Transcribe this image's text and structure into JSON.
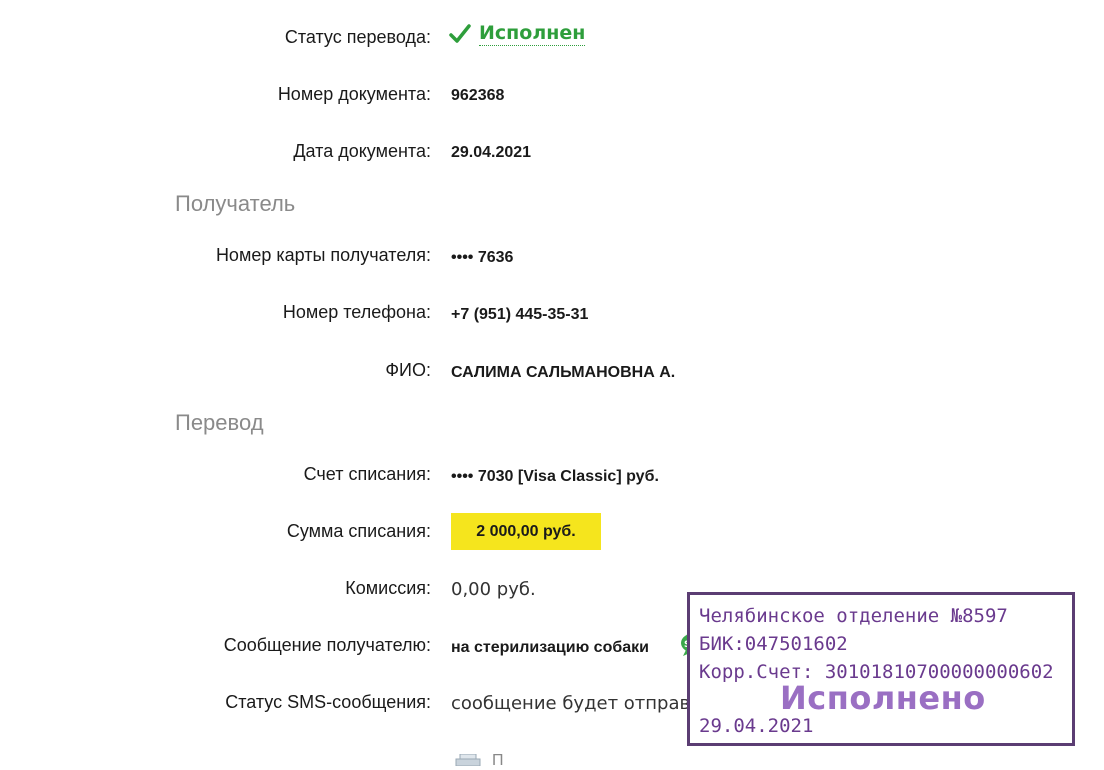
{
  "status": {
    "label": "Статус перевода:",
    "value": "Исполнен"
  },
  "document": {
    "number_label": "Номер документа:",
    "number": "962368",
    "date_label": "Дата документа:",
    "date": "29.04.2021"
  },
  "recipient": {
    "section_title": "Получатель",
    "card_label": "Номер карты получателя:",
    "card": "•••• 7636",
    "phone_label": "Номер телефона:",
    "phone": "+7 (951) 445-35-31",
    "name_label": "ФИО:",
    "name": "САЛИМА САЛЬМАНОВНА А."
  },
  "transfer": {
    "section_title": "Перевод",
    "account_label": "Счет списания:",
    "account": "•••• 7030  [Visa Classic]  руб.",
    "amount_label": "Сумма списания:",
    "amount": "2 000,00  руб.",
    "fee_label": "Комиссия:",
    "fee": "0,00 руб.",
    "message_label": "Сообщение получателю:",
    "message": "на стерилизацию собаки",
    "sms_label": "Статус SMS-сообщения:",
    "sms": "сообщение будет отправлено"
  },
  "stamp": {
    "branch": "Челябинское отделение №8597",
    "bik": "БИК:047501602",
    "corr": "Корр.Счет: 30101810700000000602",
    "done": "Исполнено",
    "date": "29.04.2021"
  },
  "icons": {
    "status": "checkmark-icon",
    "sms": "sms-bubble-icon",
    "print": "printer-icon"
  },
  "colors": {
    "success": "#2e9e3b",
    "highlight": "#f5e51d",
    "stamp": "#6a3a8e",
    "section": "#8a8a8a"
  }
}
